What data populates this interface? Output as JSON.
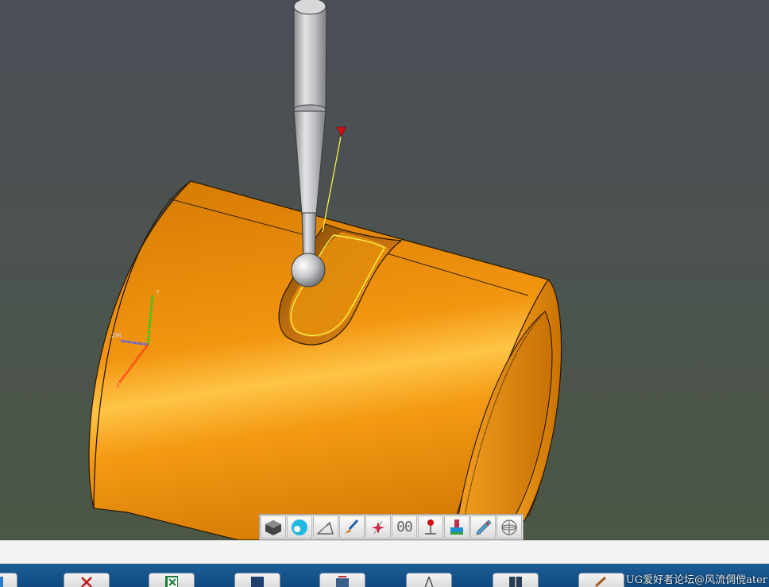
{
  "viewport": {
    "background_top": "#4a4e57",
    "background_bottom": "#4c5746",
    "part_color": "#f59a12",
    "probe_color": "#b9babd",
    "probe_path_color": "#f5f04a",
    "vector_tip_color": "#d01010"
  },
  "axes": {
    "x_label": "X",
    "y_label": "Y",
    "z_label": "ZM"
  },
  "view_toolbar": {
    "buttons": [
      {
        "icon": "shaded-cube-icon"
      },
      {
        "icon": "globe-render-icon"
      },
      {
        "icon": "edge-measure-icon"
      },
      {
        "icon": "brush-icon"
      },
      {
        "icon": "star-point-icon"
      },
      {
        "icon": "counter-icon",
        "text": "00"
      },
      {
        "icon": "probe-pin-icon"
      },
      {
        "icon": "color-plunger-icon"
      },
      {
        "icon": "pencil-icon"
      },
      {
        "icon": "wireframe-sphere-icon"
      }
    ]
  },
  "taskbar": {
    "buttons": [
      {
        "icon": "partial-app-icon"
      },
      {
        "icon": "close-x-icon"
      },
      {
        "icon": "excel-icon"
      },
      {
        "icon": "window-icon"
      },
      {
        "icon": "tool-icon"
      },
      {
        "icon": "compass-icon"
      },
      {
        "icon": "grid-window-icon"
      },
      {
        "icon": "brush-tools-icon"
      }
    ],
    "watermark": "UG爱好者论坛@风流倜傥ater"
  }
}
